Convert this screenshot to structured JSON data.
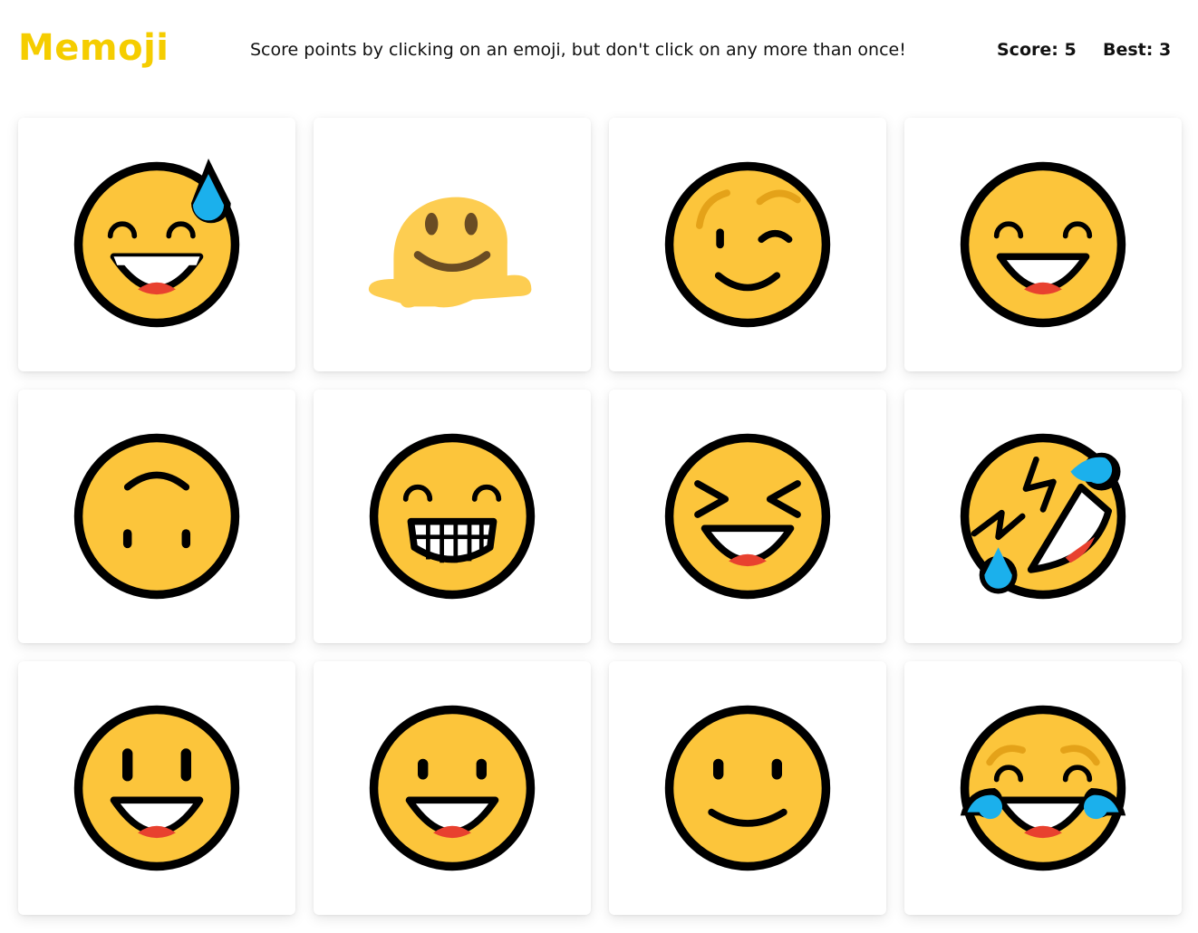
{
  "app": {
    "title": "Memoji",
    "instructions": "Score points by clicking on an emoji, but don't click on any more than once!"
  },
  "scoreboard": {
    "score_label": "Score: 5",
    "best_label": "Best: 3"
  },
  "colors": {
    "brand": "#f5cd00",
    "face": "#fcc53b",
    "outline": "#000000",
    "tear": "#1bb0ec",
    "tongue": "#e8412f",
    "brow": "#e4a219"
  },
  "cards": [
    {
      "emoji": "grinning-face-with-sweat"
    },
    {
      "emoji": "melting-face"
    },
    {
      "emoji": "winking-face"
    },
    {
      "emoji": "grinning-face-with-smiling-eyes"
    },
    {
      "emoji": "upside-down-face"
    },
    {
      "emoji": "beaming-face-with-smiling-eyes"
    },
    {
      "emoji": "grinning-squinting-face"
    },
    {
      "emoji": "rolling-on-the-floor-laughing"
    },
    {
      "emoji": "grinning-face-with-big-eyes"
    },
    {
      "emoji": "grinning-face"
    },
    {
      "emoji": "slightly-smiling-face"
    },
    {
      "emoji": "face-with-tears-of-joy"
    }
  ]
}
